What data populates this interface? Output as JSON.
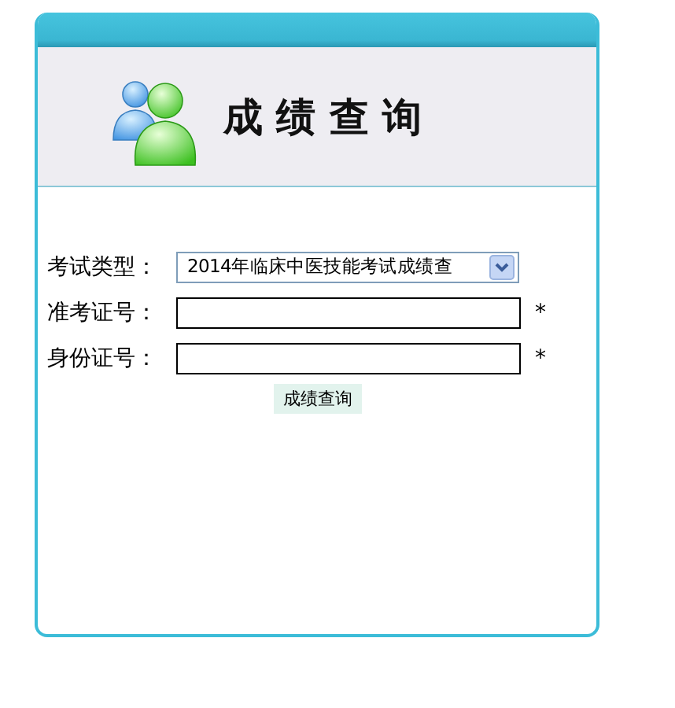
{
  "banner": {
    "title": "成 绩 查 询"
  },
  "fields": [
    {
      "kind": "select",
      "label": "考试类型：",
      "value": "2014年临床中医技能考试成绩查"
    },
    {
      "kind": "text",
      "label": "准考证号：",
      "required": "*"
    },
    {
      "kind": "text",
      "label": "身份证号：",
      "required": "*"
    }
  ],
  "submit": {
    "label": "成绩查询"
  }
}
